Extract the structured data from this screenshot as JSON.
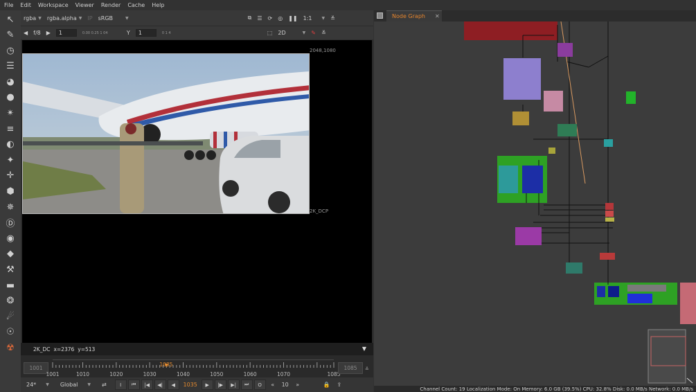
{
  "menu": [
    "File",
    "Edit",
    "Workspace",
    "Viewer",
    "Render",
    "Cache",
    "Help"
  ],
  "toolbar": {
    "tools": [
      {
        "name": "pointer-icon",
        "glyph": "↖"
      },
      {
        "name": "paint-brush-icon",
        "glyph": "✎"
      },
      {
        "name": "clock-icon",
        "glyph": "◷"
      },
      {
        "name": "channel-icon",
        "glyph": "☰"
      },
      {
        "name": "color-wheel-icon",
        "glyph": "◕"
      },
      {
        "name": "sphere-icon",
        "glyph": "●"
      },
      {
        "name": "filter-icon",
        "glyph": "✴"
      },
      {
        "name": "layers-icon",
        "glyph": "≡"
      },
      {
        "name": "keyer-icon",
        "glyph": "◐"
      },
      {
        "name": "merge-icon",
        "glyph": "✦"
      },
      {
        "name": "transform-icon",
        "glyph": "✛"
      },
      {
        "name": "3d-cube-icon",
        "glyph": "⬢"
      },
      {
        "name": "particles-icon",
        "glyph": "✵"
      },
      {
        "name": "deep-icon",
        "glyph": "Ⓓ"
      },
      {
        "name": "views-icon",
        "glyph": "◉"
      },
      {
        "name": "metadata-icon",
        "glyph": "◆"
      },
      {
        "name": "toolsets-icon",
        "glyph": "⚒"
      },
      {
        "name": "other-icon",
        "glyph": "▬"
      },
      {
        "name": "furnace-icon",
        "glyph": "❂"
      },
      {
        "name": "plugin-icon",
        "glyph": "☄"
      },
      {
        "name": "ocula-icon",
        "glyph": "☉"
      },
      {
        "name": "nuke-logo-icon",
        "glyph": "☢"
      }
    ]
  },
  "viewer": {
    "bar1": {
      "layer": "rgba",
      "channel": "rgba.alpha",
      "ip": "IP",
      "colorspace": "sRGB",
      "zoom": "1:1"
    },
    "bar2": {
      "fstop": "f/8",
      "gain": "1",
      "gain_ticks": "0.00 0.25 1 04",
      "gamma_label": "Y",
      "gamma": "1",
      "gamma_ticks": "0  1  4",
      "mode": "2D"
    },
    "format_top": "2048,1080",
    "format_bottom": "2K_DCP",
    "info": {
      "format": "2K_DC",
      "x": "x=2376",
      "y": "y=513"
    }
  },
  "timeline": {
    "in": "1001",
    "out": "1085",
    "current": "1035",
    "first": 1001,
    "last": 1085,
    "labels": [
      "1001",
      "1010",
      "1020",
      "1030",
      "1040",
      "1050",
      "1060",
      "1070",
      "1085"
    ]
  },
  "transport": {
    "fps": "24*",
    "scope": "Global",
    "frame": "1035",
    "frame_j": "0",
    "increment": "10",
    "buttons": [
      "I",
      "⏮",
      "|◀",
      "◀|",
      "◀",
      "▶",
      "|▶",
      "▶|",
      "⏭",
      "O"
    ]
  },
  "nodegraph": {
    "tab": "Node Graph",
    "close": "✕"
  },
  "status": "Channel Count: 19  Localization Mode: On  Memory: 6.0 GB (39.5%)  CPU: 32.8%  Disk: 0.0 MB/s  Network: 0.0 MB/s",
  "colors": {
    "accent": "#e5852e",
    "background": "#323232",
    "nodegraph": "#3c3c3c"
  }
}
